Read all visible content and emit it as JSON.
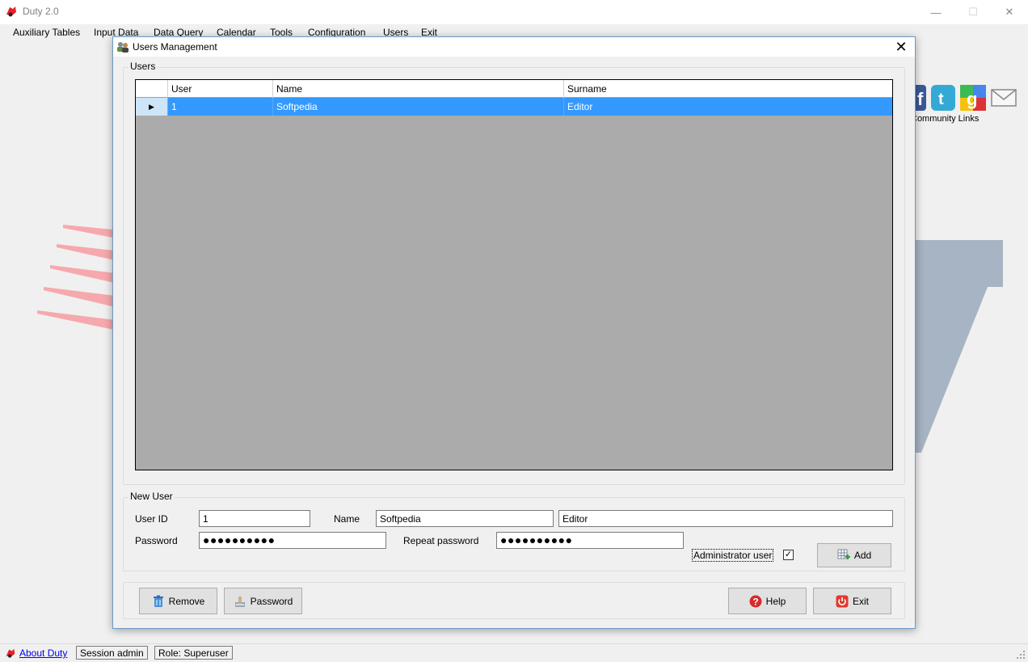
{
  "window": {
    "title": "Duty 2.0",
    "minimize_glyph": "—",
    "maximize_glyph": "☐",
    "close_glyph": "✕"
  },
  "menu": [
    "Auxiliary Tables",
    "Input Data",
    "Data Query",
    "Calendar",
    "Tools",
    "Configuration",
    "Users",
    "Exit"
  ],
  "community": {
    "label": "Community Links",
    "icons": [
      "facebook-icon",
      "twitter-icon",
      "google-icon",
      "mail-icon"
    ]
  },
  "dialog": {
    "title": "Users Management",
    "close_glyph": "✕",
    "users_group": {
      "legend": "Users",
      "columns": [
        "User",
        "Name",
        "Surname"
      ],
      "rows": [
        {
          "user": "1",
          "name": "Softpedia",
          "surname": "Editor",
          "selected": true
        }
      ],
      "current_row_marker": "▶"
    },
    "new_user_group": {
      "legend": "New User",
      "user_id_label": "User ID",
      "user_id_value": "1",
      "name_label": "Name",
      "name_value": "Softpedia",
      "surname_value": "Editor",
      "password_label": "Password",
      "password_value": "●●●●●●●●●●",
      "repeat_password_label": "Repeat password",
      "repeat_password_value": "●●●●●●●●●●",
      "admin_label": "Administrator user",
      "admin_checked": true,
      "check_glyph": "✓",
      "add_label": "Add"
    },
    "buttons": {
      "remove": "Remove",
      "password": "Password",
      "help": "Help",
      "exit": "Exit"
    }
  },
  "statusbar": {
    "about": "About Duty",
    "session": "Session admin",
    "role": "Role: Superuser"
  },
  "colors": {
    "selection": "#3399ff",
    "grid_background": "#ababab",
    "accent_red": "#e8202a",
    "watermark_red": "#f6a9ad",
    "watermark_blue": "#a6b4c3"
  }
}
